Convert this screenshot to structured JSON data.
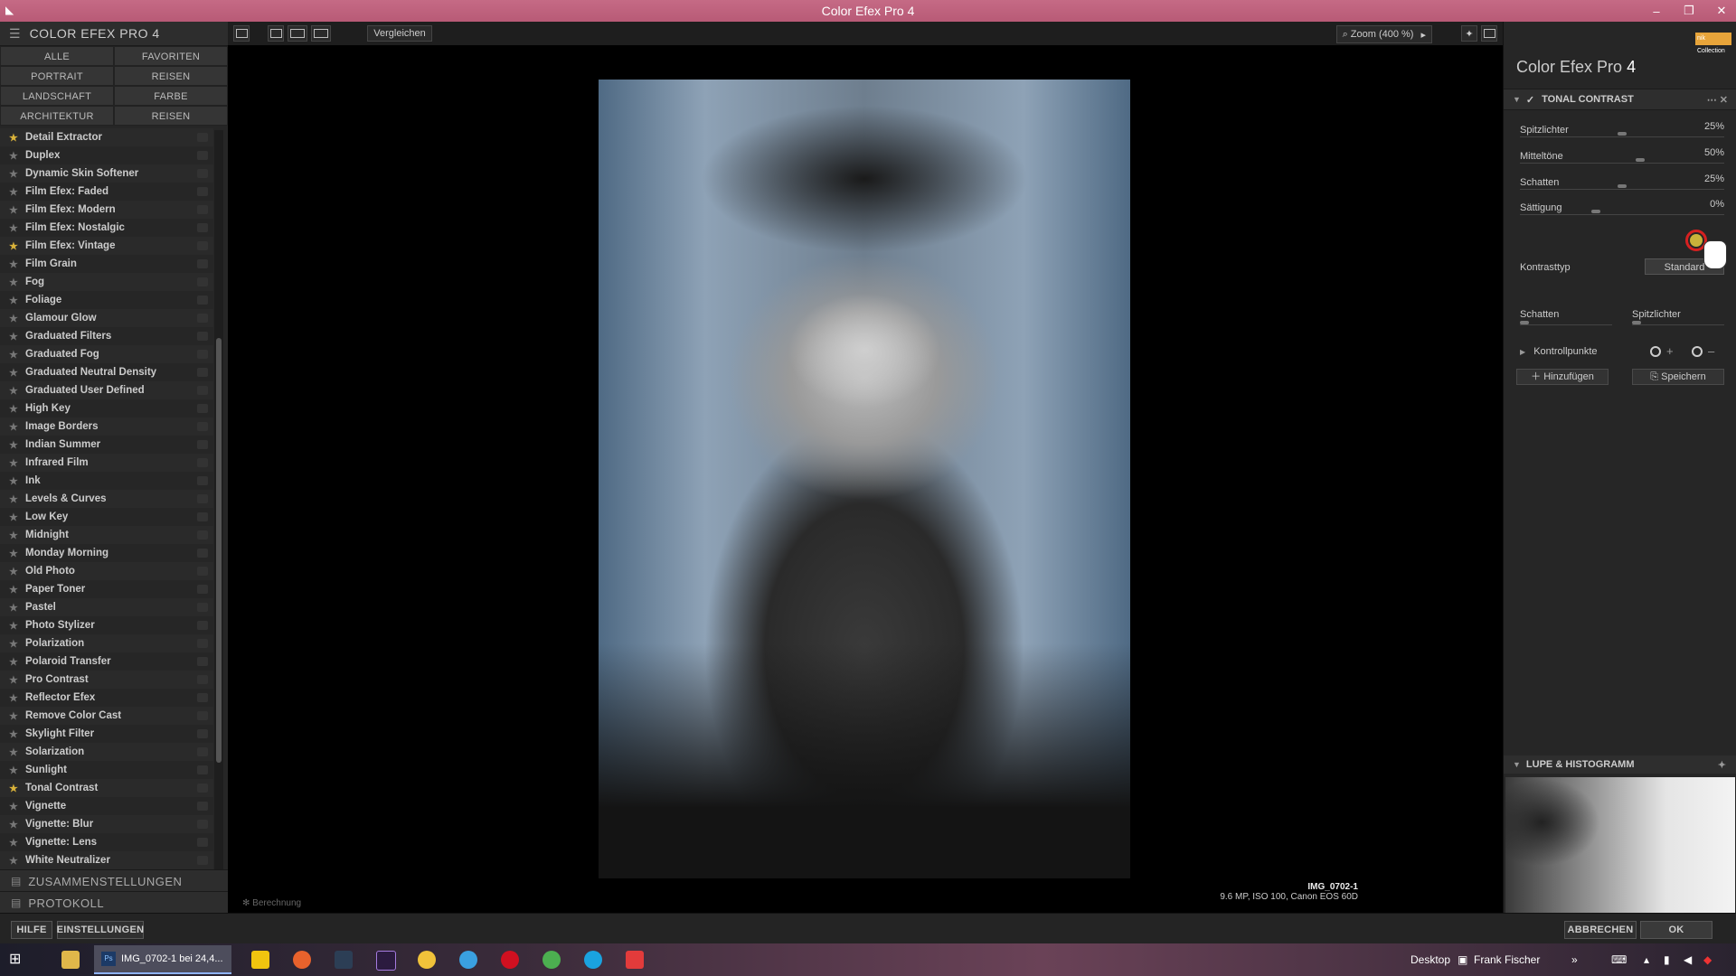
{
  "window": {
    "title": "Color Efex Pro 4",
    "min": "–",
    "max": "❐",
    "close": "✕",
    "logo": "◣"
  },
  "left": {
    "header": "COLOR EFEX PRO 4",
    "categories": [
      "ALLE",
      "FAVORITEN",
      "PORTRAIT",
      "REISEN",
      "LANDSCHAFT",
      "FARBE",
      "ARCHITEKTUR",
      "REISEN"
    ],
    "filters": [
      {
        "name": "Detail Extractor",
        "fav": true
      },
      {
        "name": "Duplex",
        "fav": false
      },
      {
        "name": "Dynamic Skin Softener",
        "fav": false
      },
      {
        "name": "Film Efex: Faded",
        "fav": false
      },
      {
        "name": "Film Efex: Modern",
        "fav": false
      },
      {
        "name": "Film Efex: Nostalgic",
        "fav": false
      },
      {
        "name": "Film Efex: Vintage",
        "fav": true
      },
      {
        "name": "Film Grain",
        "fav": false
      },
      {
        "name": "Fog",
        "fav": false
      },
      {
        "name": "Foliage",
        "fav": false
      },
      {
        "name": "Glamour Glow",
        "fav": false
      },
      {
        "name": "Graduated Filters",
        "fav": false
      },
      {
        "name": "Graduated Fog",
        "fav": false
      },
      {
        "name": "Graduated Neutral Density",
        "fav": false
      },
      {
        "name": "Graduated User Defined",
        "fav": false
      },
      {
        "name": "High Key",
        "fav": false
      },
      {
        "name": "Image Borders",
        "fav": false
      },
      {
        "name": "Indian Summer",
        "fav": false
      },
      {
        "name": "Infrared Film",
        "fav": false
      },
      {
        "name": "Ink",
        "fav": false
      },
      {
        "name": "Levels & Curves",
        "fav": false
      },
      {
        "name": "Low Key",
        "fav": false
      },
      {
        "name": "Midnight",
        "fav": false
      },
      {
        "name": "Monday Morning",
        "fav": false
      },
      {
        "name": "Old Photo",
        "fav": false
      },
      {
        "name": "Paper Toner",
        "fav": false
      },
      {
        "name": "Pastel",
        "fav": false
      },
      {
        "name": "Photo Stylizer",
        "fav": false
      },
      {
        "name": "Polarization",
        "fav": false
      },
      {
        "name": "Polaroid Transfer",
        "fav": false
      },
      {
        "name": "Pro Contrast",
        "fav": false
      },
      {
        "name": "Reflector Efex",
        "fav": false
      },
      {
        "name": "Remove Color Cast",
        "fav": false
      },
      {
        "name": "Skylight Filter",
        "fav": false
      },
      {
        "name": "Solarization",
        "fav": false
      },
      {
        "name": "Sunlight",
        "fav": false
      },
      {
        "name": "Tonal Contrast",
        "fav": true
      },
      {
        "name": "Vignette",
        "fav": false
      },
      {
        "name": "Vignette: Blur",
        "fav": false
      },
      {
        "name": "Vignette: Lens",
        "fav": false
      },
      {
        "name": "White Neutralizer",
        "fav": false
      }
    ],
    "sections": [
      "ZUSAMMENSTELLUNGEN",
      "PROTOKOLL"
    ]
  },
  "toolbar": {
    "compare": "Vergleichen",
    "zoom": "Zoom (400 %)"
  },
  "image": {
    "name": "IMG_0702-1",
    "meta": "9.6 MP, ISO 100, Canon EOS 60D",
    "status": "Berechnung"
  },
  "right": {
    "brand": "nik Collection",
    "app_name": "Color Efex Pro",
    "app_version": "4",
    "filter_title": "TONAL CONTRAST",
    "params": [
      {
        "label": "Spitzlichter",
        "value": "25%",
        "level": 0.5
      },
      {
        "label": "Mitteltöne",
        "value": "50%",
        "level": 0.59
      },
      {
        "label": "Schatten",
        "value": "25%",
        "level": 0.5
      },
      {
        "label": "Sättigung",
        "value": "0%",
        "level": 0.37
      }
    ],
    "kontrasttyp": {
      "label": "Kontrasttyp",
      "value": "Standard"
    },
    "pair": [
      {
        "label": "Schatten"
      },
      {
        "label": "Spitzlichter"
      }
    ],
    "kontrollpunkte": "Kontrollpunkte",
    "add": "Hinzufügen",
    "save": "Speichern",
    "lupe": "LUPE & HISTOGRAMM"
  },
  "bottom": {
    "help": "HILFE",
    "settings": "EINSTELLUNGEN",
    "cancel": "ABBRECHEN",
    "ok": "OK"
  },
  "taskbar": {
    "active_task": "IMG_0702-1 bei 24,4...",
    "desktop": "Desktop",
    "user": "Frank Fischer",
    "ps": "Ps"
  }
}
